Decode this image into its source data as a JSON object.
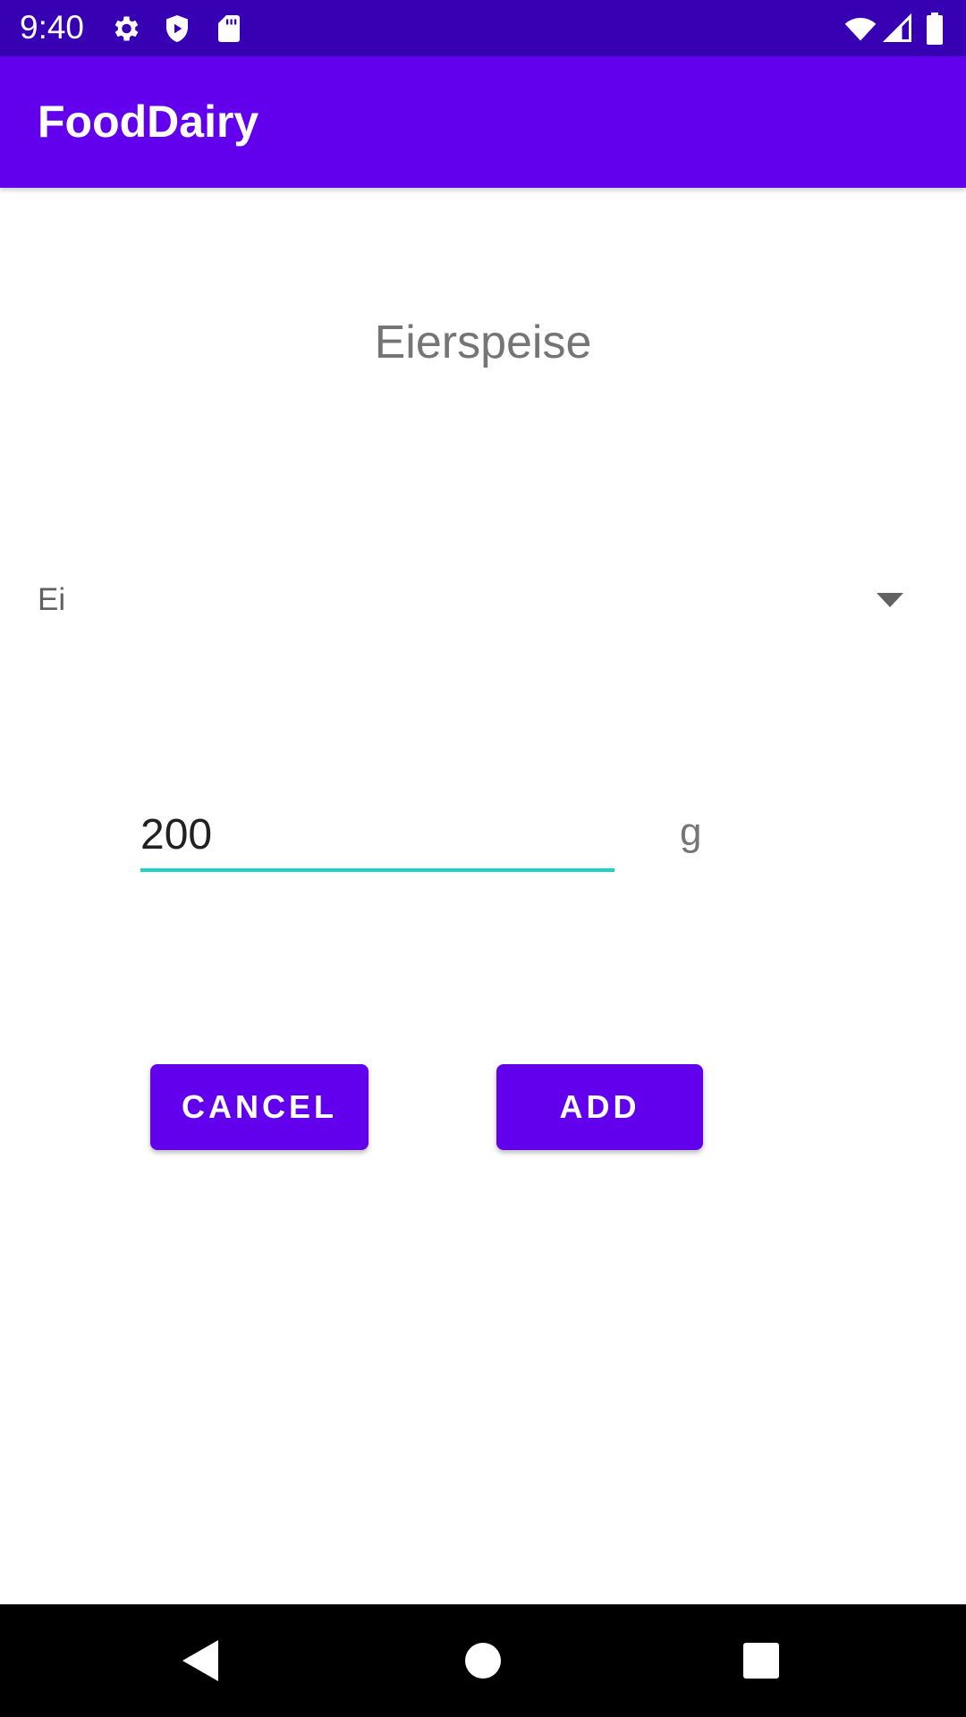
{
  "status_bar": {
    "time": "9:40",
    "icons": [
      "gear-icon",
      "shield-icon",
      "sd-card-icon",
      "wifi-icon",
      "signal-icon",
      "battery-icon"
    ]
  },
  "app_bar": {
    "title": "FoodDairy"
  },
  "recipe": {
    "title": "Eierspeise"
  },
  "ingredient_spinner": {
    "selected": "Ei"
  },
  "amount": {
    "value": "200",
    "unit": "g"
  },
  "buttons": {
    "cancel_label": "CANCEL",
    "add_label": "ADD"
  },
  "nav_bar": {
    "icons": [
      "back-icon",
      "home-icon",
      "recents-icon"
    ]
  },
  "colors": {
    "status_bar": "#3700B3",
    "primary": "#6200EE",
    "accent": "#1ED2C8",
    "text_secondary": "#757575"
  }
}
